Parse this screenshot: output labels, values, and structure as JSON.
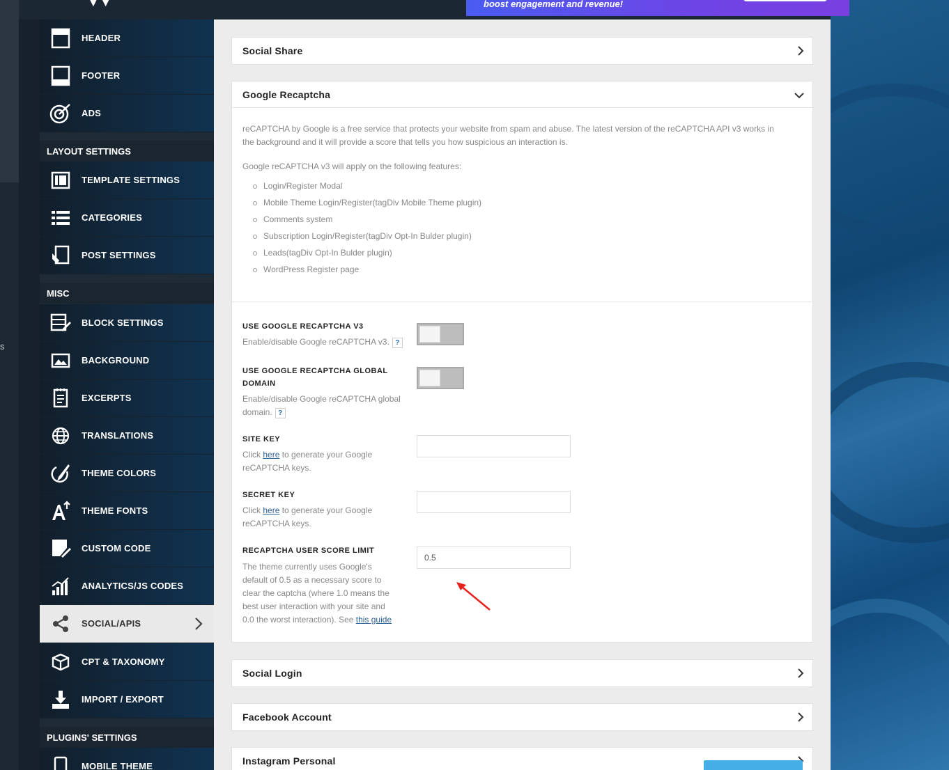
{
  "promo": {
    "text": "boost engagement and revenue!"
  },
  "sidebar": {
    "items_top": [
      {
        "label": "HEADER",
        "icon": "header-icon"
      },
      {
        "label": "FOOTER",
        "icon": "footer-icon"
      },
      {
        "label": "ADS",
        "icon": "target-icon"
      }
    ],
    "section_layout": "LAYOUT SETTINGS",
    "items_layout": [
      {
        "label": "TEMPLATE SETTINGS",
        "icon": "template-icon"
      },
      {
        "label": "CATEGORIES",
        "icon": "list-icon"
      },
      {
        "label": "POST SETTINGS",
        "icon": "post-icon"
      }
    ],
    "section_misc": "MISC",
    "items_misc": [
      {
        "label": "BLOCK SETTINGS",
        "icon": "block-icon"
      },
      {
        "label": "BACKGROUND",
        "icon": "image-icon"
      },
      {
        "label": "EXCERPTS",
        "icon": "excerpt-icon"
      },
      {
        "label": "TRANSLATIONS",
        "icon": "globe-icon"
      },
      {
        "label": "THEME COLORS",
        "icon": "brush-icon"
      },
      {
        "label": "THEME FONTS",
        "icon": "font-icon"
      },
      {
        "label": "CUSTOM CODE",
        "icon": "code-icon"
      },
      {
        "label": "ANALYTICS/JS CODES",
        "icon": "analytics-icon"
      },
      {
        "label": "SOCIAL/APIS",
        "icon": "share-icon",
        "active": true
      },
      {
        "label": "CPT & TAXONOMY",
        "icon": "cube-icon"
      },
      {
        "label": "IMPORT / EXPORT",
        "icon": "download-icon"
      }
    ],
    "section_plugins": "PLUGINS' SETTINGS",
    "items_plugins": [
      {
        "label": "MOBILE THEME",
        "icon": "mobile-icon"
      }
    ]
  },
  "panels": {
    "social_share": "Social Share",
    "google_recaptcha": "Google Recaptcha",
    "social_login": "Social Login",
    "facebook_account": "Facebook Account",
    "instagram_personal": "Instagram Personal"
  },
  "recaptcha": {
    "intro_line1": "reCAPTCHA by Google is a free service that protects your website from spam and abuse. The latest version of the reCAPTCHA API v3 works in",
    "intro_line2": "the background and it will provide a score that tells you how suspicious an interaction is.",
    "features_heading": "Google reCAPTCHA v3 will apply on the following features:",
    "features": [
      "Login/Register Modal",
      "Mobile Theme Login/Register(tagDiv Mobile Theme plugin)",
      "Comments system",
      "Subscription Login/Register(tagDiv Opt-In Bulder plugin)",
      "Leads(tagDiv Opt-In Bulder plugin)",
      "WordPress Register page"
    ],
    "use_v3": {
      "title": "USE GOOGLE RECAPTCHA V3",
      "desc": "Enable/disable Google reCAPTCHA v3.",
      "help": "?"
    },
    "use_global_title1": "USE GOOGLE RECAPTCHA GLOBAL",
    "use_global_title2": "DOMAIN",
    "use_global_desc1": "Enable/disable Google reCAPTCHA global",
    "use_global_desc2": "domain.",
    "use_global_help": "?",
    "site_key": {
      "title": "SITE KEY",
      "pre": "Click ",
      "link": "here",
      "post": " to generate your Google",
      "line2": "reCAPTCHA keys.",
      "value": ""
    },
    "secret_key": {
      "title": "SECRET KEY",
      "pre": "Click ",
      "link": "here",
      "post": " to generate your Google",
      "line2": "reCAPTCHA keys.",
      "value": ""
    },
    "score_limit": {
      "title": "RECAPTCHA USER SCORE LIMIT",
      "lines": [
        "The theme currently uses Google's",
        "default of 0.5 as a necessary score to",
        "clear the captcha (where 1.0 means the",
        "best user interaction with your site and"
      ],
      "last_pre": "0.0 the worst interaction). See ",
      "last_link": "this guide",
      "value": "0.5"
    }
  },
  "colors": {
    "accent_arrow": "#e8211b",
    "save_button": "#46aee6",
    "promo": "#6e44e6"
  }
}
